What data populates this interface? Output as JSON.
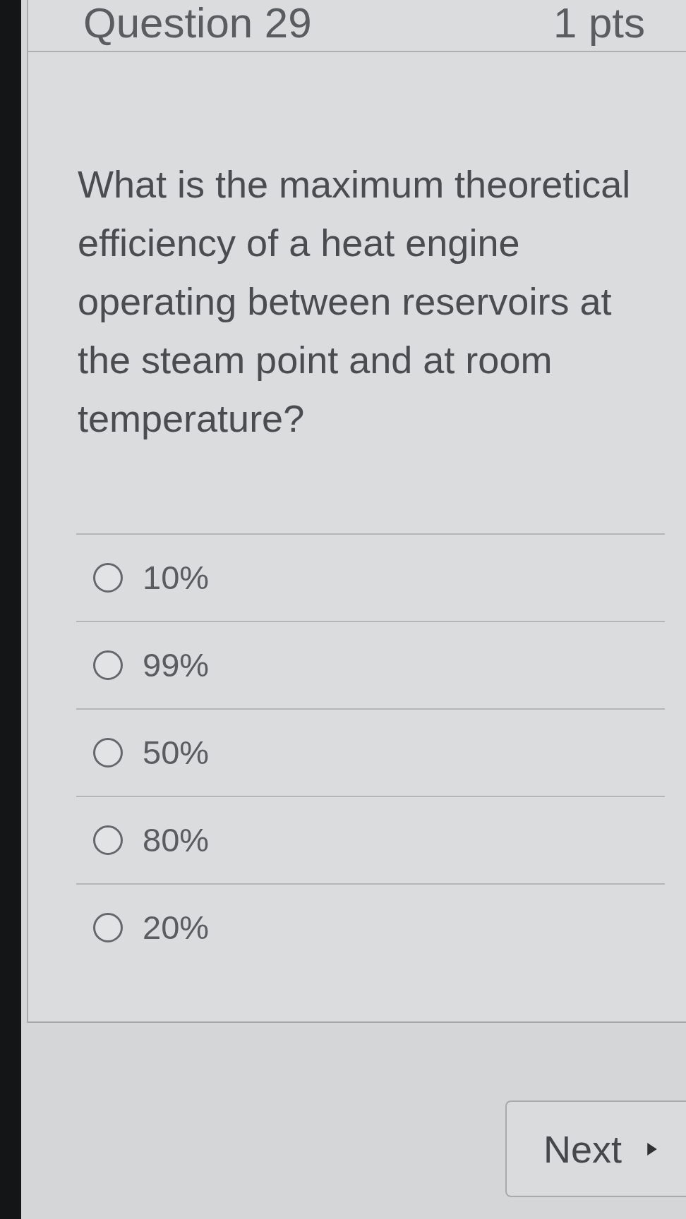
{
  "quiz_header": {
    "title": "Question 29",
    "points": "1 pts"
  },
  "question": {
    "text": "What is the maximum theoretical efficiency of a heat engine operating between reservoirs at the steam point and at room temperature?"
  },
  "options": [
    {
      "label": "10%",
      "selected": false
    },
    {
      "label": "99%",
      "selected": false
    },
    {
      "label": "50%",
      "selected": false
    },
    {
      "label": "80%",
      "selected": false
    },
    {
      "label": "20%",
      "selected": false
    }
  ],
  "next_button": {
    "label": "Next"
  }
}
